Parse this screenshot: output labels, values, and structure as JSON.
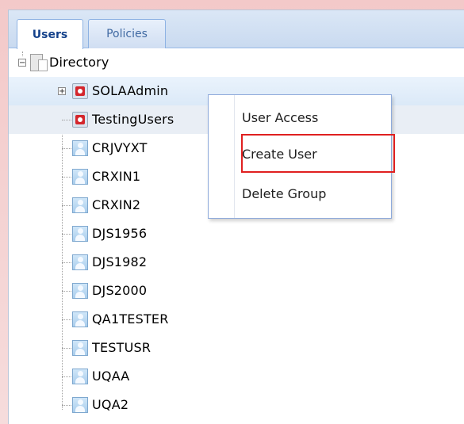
{
  "tabs": [
    {
      "label": "Users",
      "active": true
    },
    {
      "label": "Policies",
      "active": false
    }
  ],
  "tree": {
    "root": {
      "label": "Directory",
      "icon": "directory-icon"
    },
    "groups": [
      {
        "label": "SOLAAdmin",
        "icon": "group-icon",
        "collapsed": true
      },
      {
        "label": "TestingUsers",
        "icon": "group-icon",
        "selected": true
      }
    ],
    "users": [
      "CRJVYXT",
      "CRXIN1",
      "CRXIN2",
      "DJS1956",
      "DJS1982",
      "DJS2000",
      "QA1TESTER",
      "TESTUSR",
      "UQAA",
      "UQA2"
    ]
  },
  "context_menu": {
    "items": [
      "User Access",
      "Create User",
      "Delete Group"
    ],
    "highlighted": "Create User"
  },
  "colors": {
    "accent": "#15428b",
    "highlight_border": "#e02020",
    "frame": "#f3c9c9"
  }
}
